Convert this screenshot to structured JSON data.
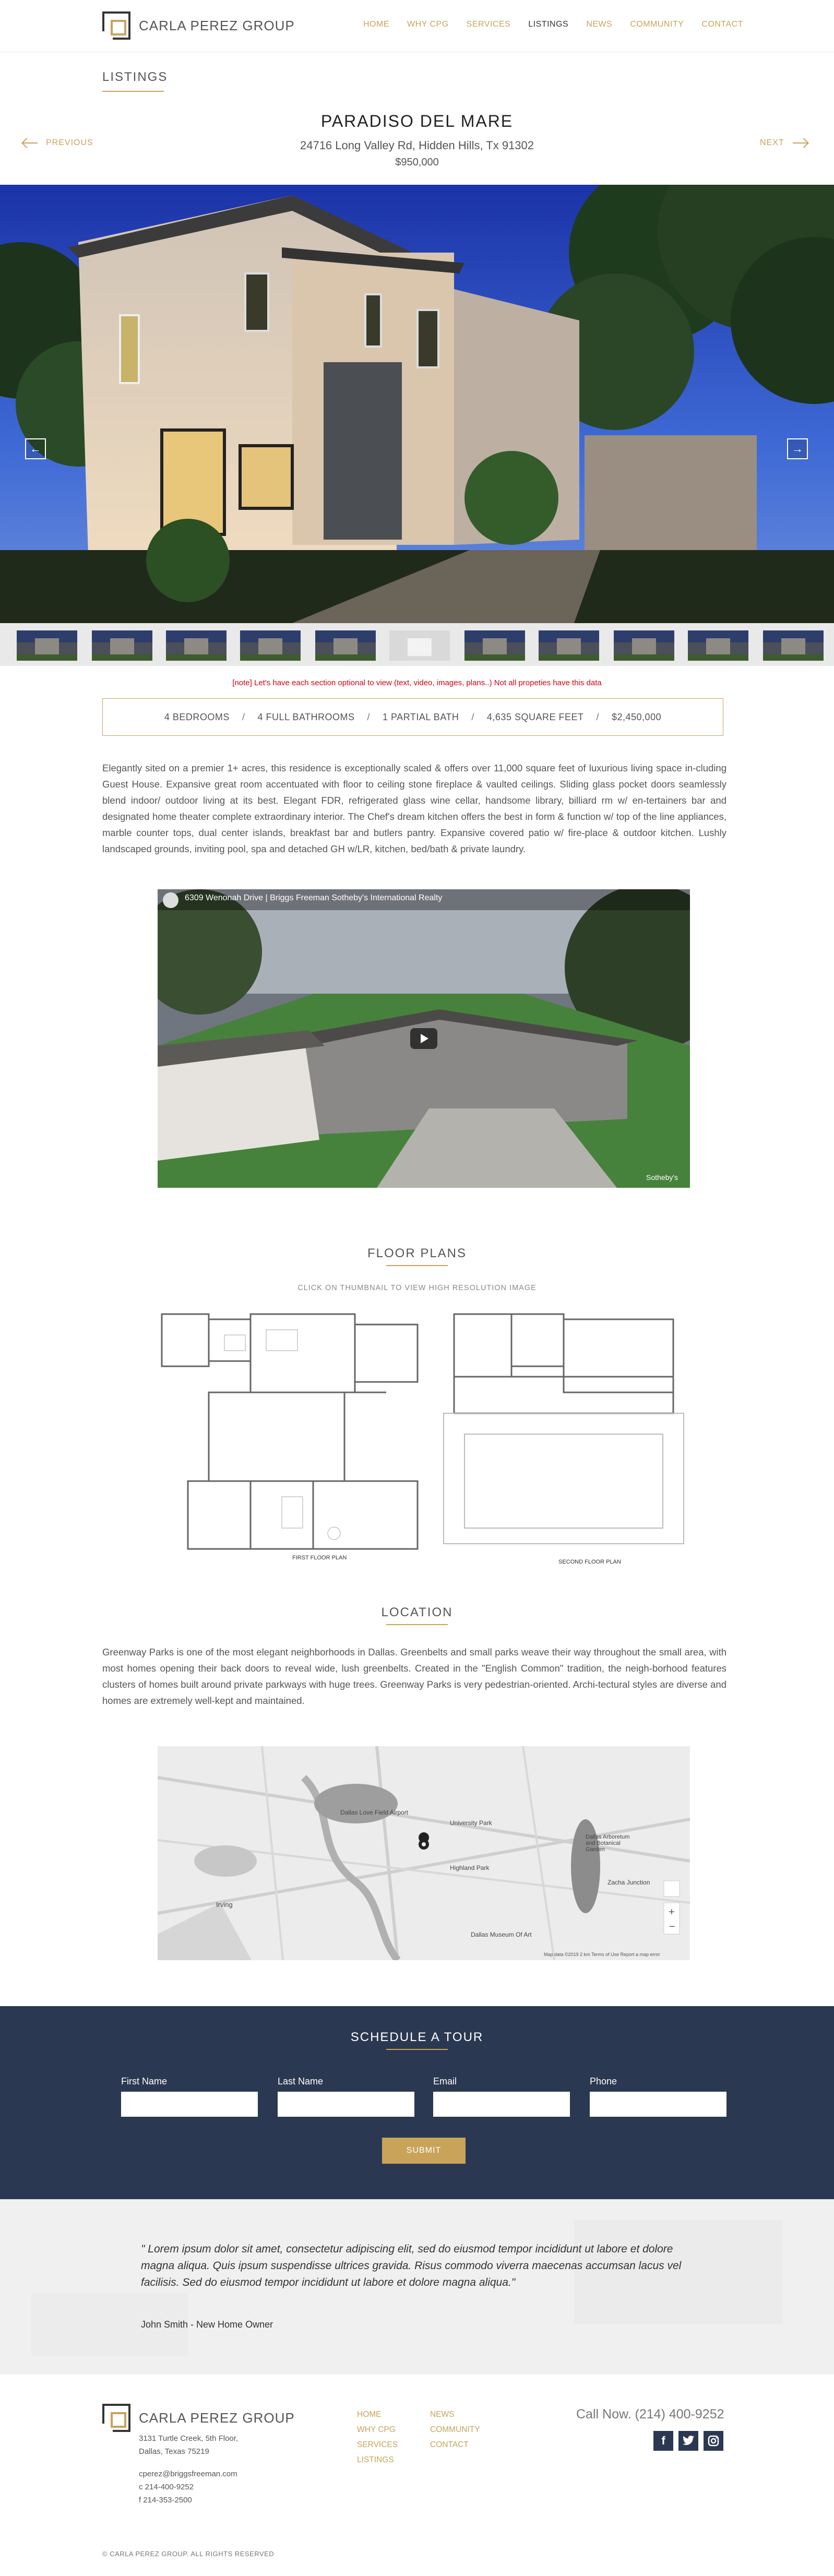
{
  "brand": {
    "name": "CARLA PEREZ GROUP",
    "accent": "#c9a35a",
    "navy": "#2b3851"
  },
  "nav": [
    {
      "label": "HOME"
    },
    {
      "label": "WHY CPG"
    },
    {
      "label": "SERVICES"
    },
    {
      "label": "LISTINGS",
      "active": true
    },
    {
      "label": "NEWS"
    },
    {
      "label": "COMMUNITY"
    },
    {
      "label": "CONTACT"
    }
  ],
  "page": {
    "section_label": "LISTINGS",
    "prev_label": "PREVIOUS",
    "next_label": "NEXT"
  },
  "property": {
    "title": "PARADISO DEL MARE",
    "address": "24716 Long Valley Rd, Hidden Hills, Tx 91302",
    "price": "$950,000",
    "note": "[note] Let's have each section optional to view (text, video, images, plans..) Not all propeties have this data",
    "stats": [
      "4 BEDROOMS",
      "4 FULL BATHROOMS",
      "1 PARTIAL BATH",
      "4,635 SQUARE FEET",
      "$2,450,000"
    ],
    "description": "Elegantly sited on a premier 1+ acres, this residence is exceptionally scaled & offers over 11,000 square feet of luxurious living space in-cluding Guest House. Expansive great room accentuated with floor to ceiling stone fireplace & vaulted ceilings. Sliding glass pocket doors seamlessly blend indoor/ outdoor living at its best. Elegant FDR, refrigerated glass wine cellar, handsome library, billiard rm w/ en-tertainers bar and designated home theater complete extraordinary interior. The Chef's dream kitchen offers the best in form & function w/ top of the line appliances, marble counter tops, dual center islands, breakfast bar and butlers pantry. Expansive covered patio w/ fire-place & outdoor kitchen. Lushly landscaped grounds, inviting pool, spa and detached GH w/LR, kitchen, bed/bath & private laundry."
  },
  "video": {
    "title": "6309 Wenonah Drive | Briggs Freeman Sotheby's International Realty",
    "watermark": "Sotheby's"
  },
  "floor_plans": {
    "title": "FLOOR PLANS",
    "subtitle": "CLICK ON THUMBNAIL TO VIEW HIGH RESOLUTION IMAGE",
    "plan1_caption": "FIRST FLOOR PLAN",
    "plan2_caption": "SECOND FLOOR PLAN"
  },
  "location": {
    "title": "LOCATION",
    "text": "Greenway Parks is one of the most elegant neighborhoods in Dallas. Greenbelts and small parks weave their way throughout the small area, with most homes opening their back doors to reveal wide, lush greenbelts. Created in the \"English Common\" tradition, the neigh-borhood features clusters of homes built around private parkways with huge trees. Greenway Parks is very pedestrian-oriented. Archi-tectural styles are diverse and homes are extremely well-kept and maintained.",
    "map_labels": [
      "Dallas Love Field Airport",
      "University Park",
      "Highland Park",
      "Dallas Arboretum and Botanical Garden",
      "Irving",
      "Dallas Museum Of Art",
      "Zacha Junction"
    ],
    "map_footer": "Map data ©2019   2 km   Terms of Use   Report a map error"
  },
  "tour": {
    "title": "SCHEDULE A TOUR",
    "fields": [
      {
        "label": "First Name"
      },
      {
        "label": "Last Name"
      },
      {
        "label": "Email"
      },
      {
        "label": "Phone"
      }
    ],
    "submit": "SUBMIT"
  },
  "testimonial": {
    "quote": "\" Lorem ipsum dolor sit amet, consectetur adipiscing elit, sed do eiusmod tempor incididunt ut labore et dolore magna aliqua. Quis ipsum suspendisse ultrices gravida. Risus commodo viverra maecenas accumsan lacus vel facilisis. Sed do eiusmod tempor incididunt ut labore et dolore magna aliqua.\"",
    "author": "John Smith - New Home Owner"
  },
  "footer": {
    "address1": "3131 Turtle Creek, 5th Floor,",
    "address2": "Dallas, Texas  75219",
    "email": "cperez@briggsfreeman.com",
    "cell": "c 214-400-9252",
    "fax": "f 214-353-2500",
    "links_col1": [
      "HOME",
      "WHY CPG",
      "SERVICES",
      "LISTINGS"
    ],
    "links_col2": [
      "NEWS",
      "COMMUNITY",
      "CONTACT"
    ],
    "call": "Call Now. (214) 400-9252",
    "copyright": "© CARLA PEREZ GROUP. ALL RIGHTS RESERVED"
  }
}
